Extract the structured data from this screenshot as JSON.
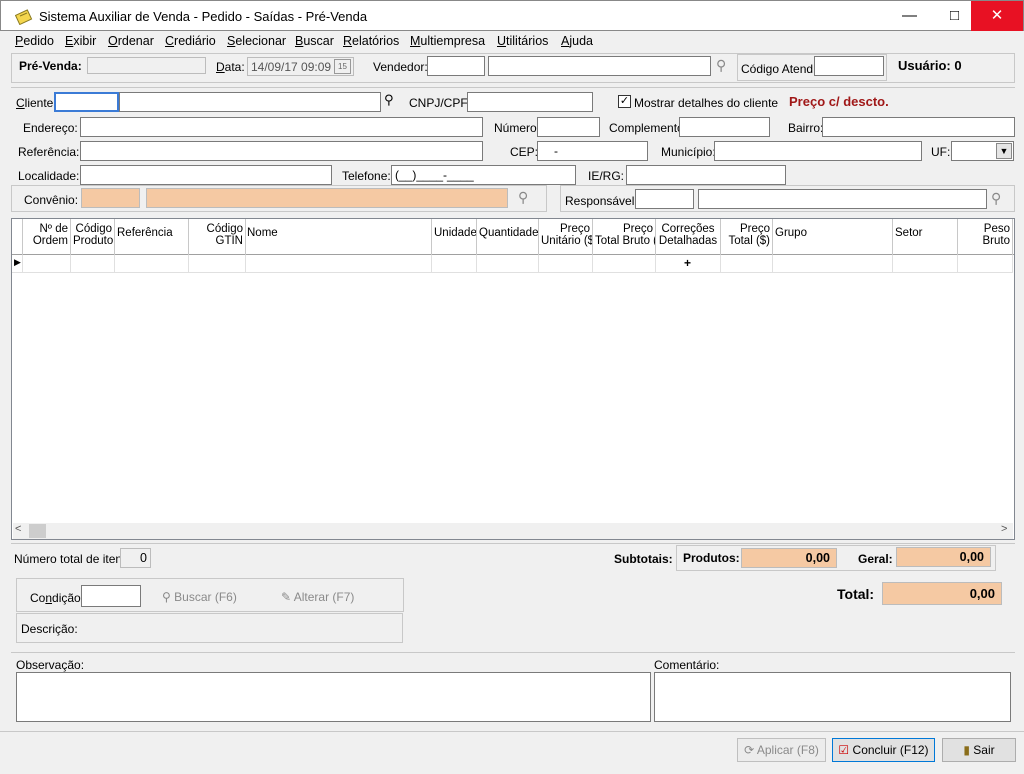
{
  "window": {
    "title": "Sistema Auxiliar de Venda - Pedido - Saídas - Pré-Venda",
    "minimize": "—",
    "maximize": "□",
    "close": "✕"
  },
  "menu": [
    {
      "key": "P",
      "rest": "edido"
    },
    {
      "key": "E",
      "rest": "xibir"
    },
    {
      "key": "O",
      "rest": "rdenar"
    },
    {
      "key": "C",
      "rest": "rediário"
    },
    {
      "key": "S",
      "rest": "elecionar"
    },
    {
      "key": "B",
      "rest": "uscar"
    },
    {
      "key": "R",
      "rest": "elatórios"
    },
    {
      "key": "M",
      "rest": "ultiempresa"
    },
    {
      "key": "U",
      "rest": "tilitários"
    },
    {
      "key": "A",
      "rest": "juda"
    }
  ],
  "header": {
    "prevenda_label": "Pré-Venda:",
    "prevenda_value": "",
    "data_label": "Data:",
    "data_value": "14/09/17 09:09",
    "vendedor_label": "Vendedor:",
    "codigo_atend_label": "Código Atend.:",
    "usuario_label": "Usuário: 0"
  },
  "cliente": {
    "cliente_label": "Cliente:",
    "cnpj_label": "CNPJ/CPF:",
    "mostrar_label": "Mostrar detalhes do cliente",
    "preco_label": "Preço c/ descto.",
    "endereco_label": "Endereço:",
    "numero_label": "Número:",
    "complemento_label": "Complemento:",
    "bairro_label": "Bairro:",
    "referencia_label": "Referência:",
    "cep_label": "CEP:",
    "cep_value": "-",
    "municipio_label": "Município:",
    "uf_label": "UF:",
    "localidade_label": "Localidade:",
    "telefone_label": "Telefone:",
    "telefone_value": "(__)____-____",
    "ierg_label": "IE/RG:",
    "convenio_label": "Convênio:",
    "responsavel_label": "Responsável:"
  },
  "grid": {
    "columns": [
      {
        "l1": "Nº de",
        "l2": "Ordem"
      },
      {
        "l1": "Código",
        "l2": "Produto"
      },
      {
        "l1": "Referência",
        "l2": ""
      },
      {
        "l1": "Código",
        "l2": "GTIN"
      },
      {
        "l1": "Nome",
        "l2": ""
      },
      {
        "l1": "Unidade",
        "l2": ""
      },
      {
        "l1": "Quantidade",
        "l2": ""
      },
      {
        "l1": "Preço",
        "l2": "Unitário ($)"
      },
      {
        "l1": "Preço",
        "l2": "Total Bruto ($)"
      },
      {
        "l1": "Correções",
        "l2": "Detalhadas"
      },
      {
        "l1": "Preço",
        "l2": "Total ($)"
      },
      {
        "l1": "Grupo",
        "l2": ""
      },
      {
        "l1": "Setor",
        "l2": ""
      },
      {
        "l1": "Peso",
        "l2": "Bruto"
      }
    ],
    "row_marker": "▶",
    "plus": "+",
    "scroll_left": "<",
    "scroll_right": ">"
  },
  "totals": {
    "num_itens_label": "Número total de itens:",
    "num_itens_value": "0",
    "subtotais_label": "Subtotais:",
    "produtos_label": "Produtos:",
    "produtos_value": "0,00",
    "geral_label": "Geral:",
    "geral_value": "0,00",
    "total_label": "Total:",
    "total_value": "0,00"
  },
  "condicao": {
    "label": "Condição:",
    "buscar": "Buscar (F6)",
    "alterar": "Alterar (F7)",
    "descricao_label": "Descrição:"
  },
  "obs": {
    "observacao_label": "Observação:",
    "comentario_label": "Comentário:"
  },
  "footer": {
    "aplicar": "Aplicar (F8)",
    "concluir": "Concluir (F12)",
    "sair": "Sair"
  }
}
